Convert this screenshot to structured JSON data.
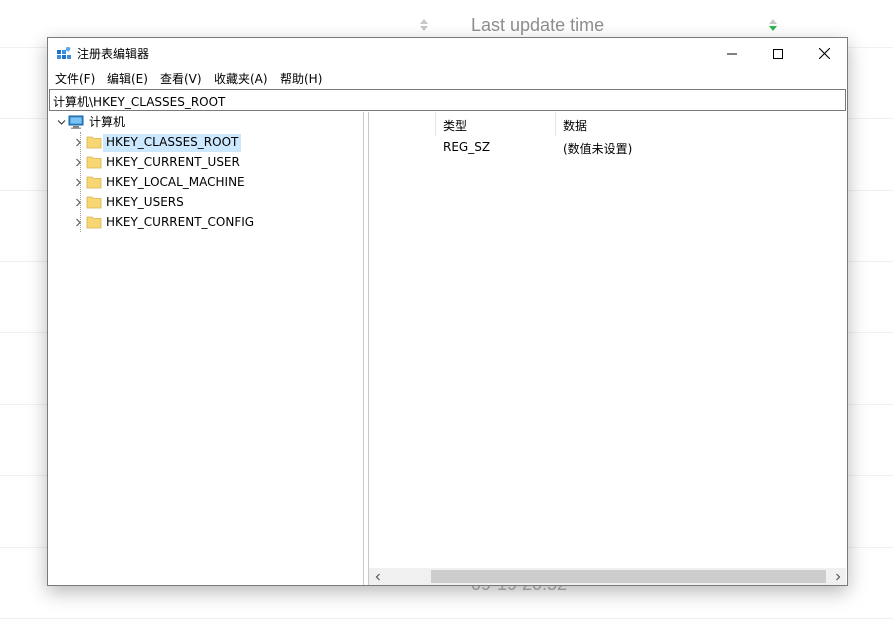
{
  "background_page": {
    "column_title": "Last update time",
    "ghost_text": "09-19 20:52",
    "sort_accent_color": "#2db84d"
  },
  "window": {
    "title": "注册表编辑器",
    "icon": "regedit-icon",
    "buttons": {
      "minimize": "minimize-icon",
      "maximize": "maximize-icon",
      "close": "close-icon"
    }
  },
  "menu": [
    {
      "label": "文件(F)"
    },
    {
      "label": "编辑(E)"
    },
    {
      "label": "查看(V)"
    },
    {
      "label": "收藏夹(A)"
    },
    {
      "label": "帮助(H)"
    }
  ],
  "address": "计算机\\HKEY_CLASSES_ROOT",
  "tree": {
    "root": {
      "label": "计算机",
      "icon": "computer-icon",
      "expanded": true
    },
    "children": [
      {
        "label": "HKEY_CLASSES_ROOT",
        "selected": true
      },
      {
        "label": "HKEY_CURRENT_USER",
        "selected": false
      },
      {
        "label": "HKEY_LOCAL_MACHINE",
        "selected": false
      },
      {
        "label": "HKEY_USERS",
        "selected": false
      },
      {
        "label": "HKEY_CURRENT_CONFIG",
        "selected": false
      }
    ]
  },
  "list": {
    "columns": [
      "",
      "类型",
      "数据"
    ],
    "rows": [
      {
        "name": "",
        "type": "REG_SZ",
        "data": "(数值未设置)"
      }
    ]
  },
  "colors": {
    "selection": "#cce8ff",
    "folder": "#f7d774",
    "window_border": "#7a7a7a"
  }
}
